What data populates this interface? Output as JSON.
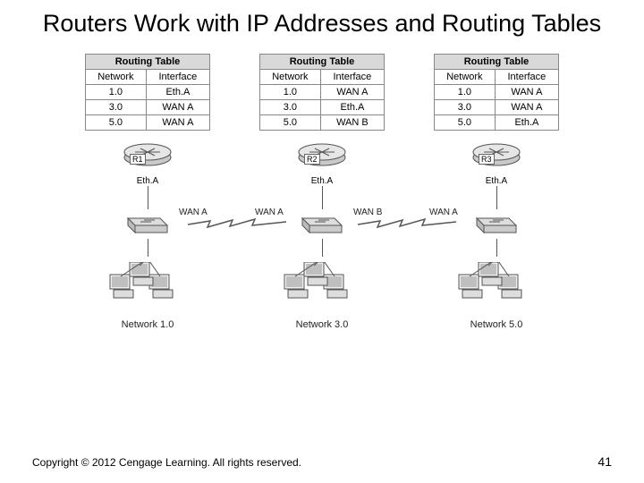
{
  "title": "Routers Work with IP Addresses and Routing Tables",
  "table_title": "Routing Table",
  "col_network": "Network",
  "col_interface": "Interface",
  "tables": [
    {
      "rows": [
        {
          "n": "1.0",
          "i": "Eth.A"
        },
        {
          "n": "3.0",
          "i": "WAN A"
        },
        {
          "n": "5.0",
          "i": "WAN A"
        }
      ]
    },
    {
      "rows": [
        {
          "n": "1.0",
          "i": "WAN A"
        },
        {
          "n": "3.0",
          "i": "Eth.A"
        },
        {
          "n": "5.0",
          "i": "WAN B"
        }
      ]
    },
    {
      "rows": [
        {
          "n": "1.0",
          "i": "WAN A"
        },
        {
          "n": "3.0",
          "i": "WAN A"
        },
        {
          "n": "5.0",
          "i": "Eth.A"
        }
      ]
    }
  ],
  "routers": [
    {
      "tag": "R1",
      "eth": "Eth.A"
    },
    {
      "tag": "R2",
      "eth": "Eth.A"
    },
    {
      "tag": "R3",
      "eth": "Eth.A"
    }
  ],
  "wan_labels": {
    "r1_right": "WAN A",
    "r2_left": "WAN A",
    "r2_right": "WAN B",
    "r3_left": "WAN A"
  },
  "network_labels": [
    "Network 1.0",
    "Network 3.0",
    "Network 5.0"
  ],
  "copyright": "Copyright © 2012 Cengage Learning. All rights reserved.",
  "page_number": "41"
}
